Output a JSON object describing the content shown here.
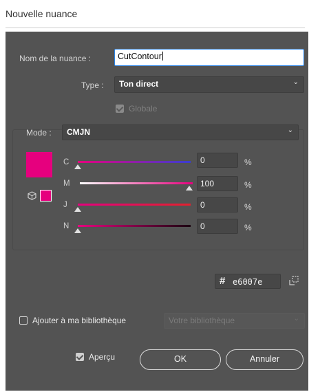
{
  "dialog": {
    "title": "Nouvelle nuance"
  },
  "name_field": {
    "label": "Nom de la nuance :",
    "value": "CutContour"
  },
  "type_field": {
    "label": "Type :",
    "value": "Ton direct"
  },
  "global_checkbox": {
    "label": "Globale",
    "checked": true,
    "enabled": false
  },
  "mode": {
    "label": "Mode :",
    "value": "CMJN"
  },
  "channels": [
    {
      "letter": "C",
      "value": "0",
      "unit": "%"
    },
    {
      "letter": "M",
      "value": "100",
      "unit": "%"
    },
    {
      "letter": "J",
      "value": "0",
      "unit": "%"
    },
    {
      "letter": "N",
      "value": "0",
      "unit": "%"
    }
  ],
  "hex": {
    "symbol": "#",
    "value": "e6007e"
  },
  "swatch_color": "#e6007e",
  "library": {
    "checkbox_label": "Ajouter à ma bibliothèque",
    "checked": false,
    "dropdown_placeholder": "Votre bibliothèque"
  },
  "preview": {
    "label": "Aperçu",
    "checked": true
  },
  "buttons": {
    "ok": "OK",
    "cancel": "Annuler"
  }
}
